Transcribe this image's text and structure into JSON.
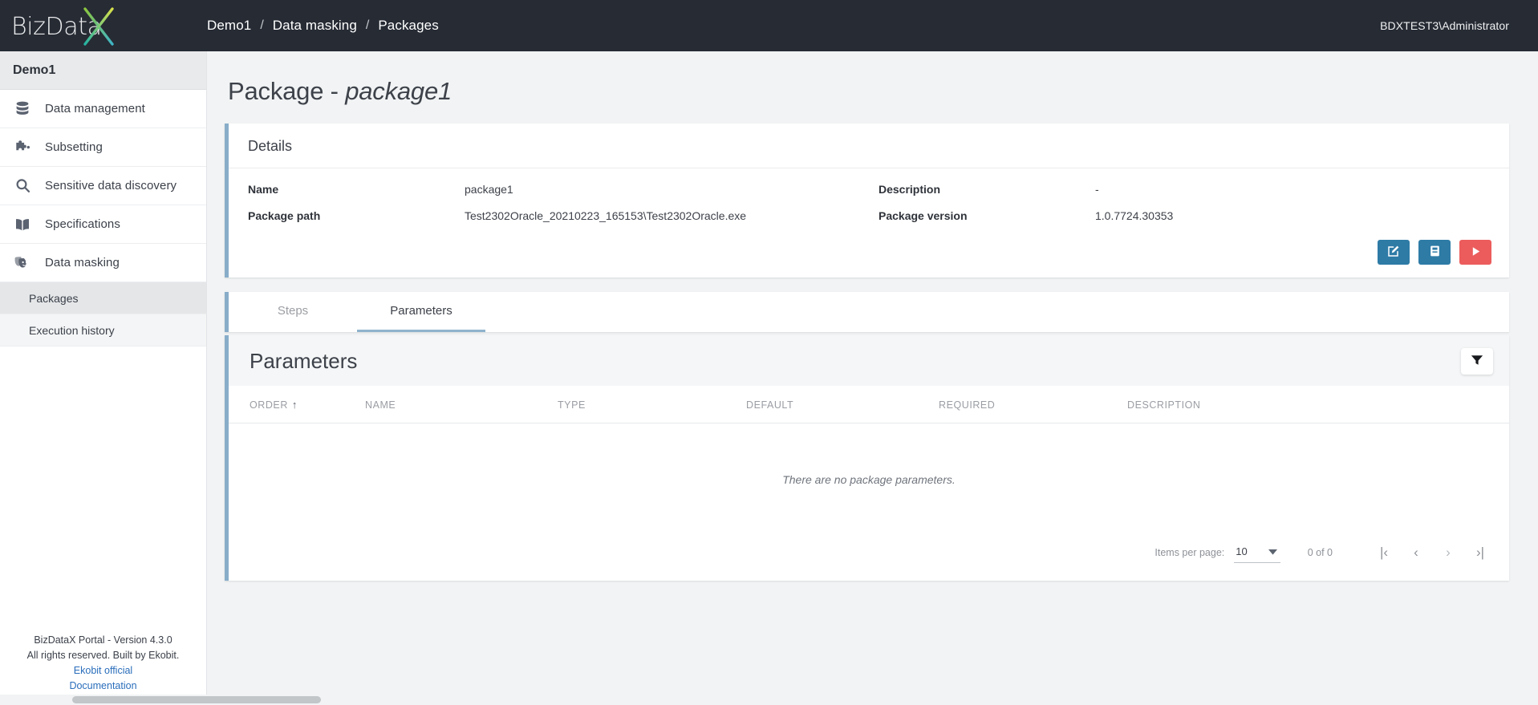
{
  "brand": {
    "logo_text": "BizData",
    "logo_mark": "X",
    "accent_start": "#d8e04a",
    "accent_end": "#25b2a3"
  },
  "topbar": {
    "breadcrumb": [
      {
        "label": "Demo1"
      },
      {
        "label": "Data masking"
      },
      {
        "label": "Packages"
      }
    ],
    "separator": "/",
    "user": "BDXTEST3\\Administrator"
  },
  "sidebar": {
    "project": "Demo1",
    "items": [
      {
        "label": "Data management",
        "icon": "database-icon"
      },
      {
        "label": "Subsetting",
        "icon": "puzzle-icon"
      },
      {
        "label": "Sensitive data discovery",
        "icon": "search-icon"
      },
      {
        "label": "Specifications",
        "icon": "book-icon"
      },
      {
        "label": "Data masking",
        "icon": "masks-icon"
      }
    ],
    "subitems": [
      {
        "label": "Packages",
        "active": true
      },
      {
        "label": "Execution history",
        "active": false
      }
    ],
    "footer": {
      "line1": "BizDataX Portal - Version 4.3.0",
      "line2": "All rights reserved. Built by Ekobit.",
      "link1": "Ekobit official",
      "link2": "Documentation"
    }
  },
  "page": {
    "title_prefix": "Package - ",
    "title_name": "package1"
  },
  "details": {
    "heading": "Details",
    "name_label": "Name",
    "name_value": "package1",
    "path_label": "Package path",
    "path_value": "Test2302Oracle_20210223_165153\\Test2302Oracle.exe",
    "description_label": "Description",
    "description_value": "-",
    "version_label": "Package version",
    "version_value": "1.0.7724.30353",
    "actions": [
      {
        "name": "edit-package-button",
        "icon": "edit-icon",
        "color": "#2e7ba6"
      },
      {
        "name": "save-package-button",
        "icon": "document-icon",
        "color": "#2e7ba6"
      },
      {
        "name": "run-package-button",
        "icon": "play-icon",
        "color": "#ec5c5c"
      }
    ]
  },
  "tabs": [
    {
      "label": "Steps",
      "active": false
    },
    {
      "label": "Parameters",
      "active": true
    }
  ],
  "parameters": {
    "title": "Parameters",
    "filter_icon": "filter-icon",
    "columns": [
      {
        "label": "ORDER",
        "sorted": true,
        "sort_dir": "↑"
      },
      {
        "label": "NAME",
        "sorted": false
      },
      {
        "label": "TYPE",
        "sorted": false
      },
      {
        "label": "DEFAULT",
        "sorted": false
      },
      {
        "label": "REQUIRED",
        "sorted": false
      },
      {
        "label": "DESCRIPTION",
        "sorted": false
      }
    ],
    "rows": [],
    "empty_message": "There are no package parameters.",
    "paginator": {
      "items_per_page_label": "Items per page:",
      "items_per_page_value": "10",
      "range_label": "0 of 0",
      "first_icon": "|‹",
      "prev_icon": "‹",
      "next_icon": "›",
      "last_icon": "›|"
    }
  }
}
